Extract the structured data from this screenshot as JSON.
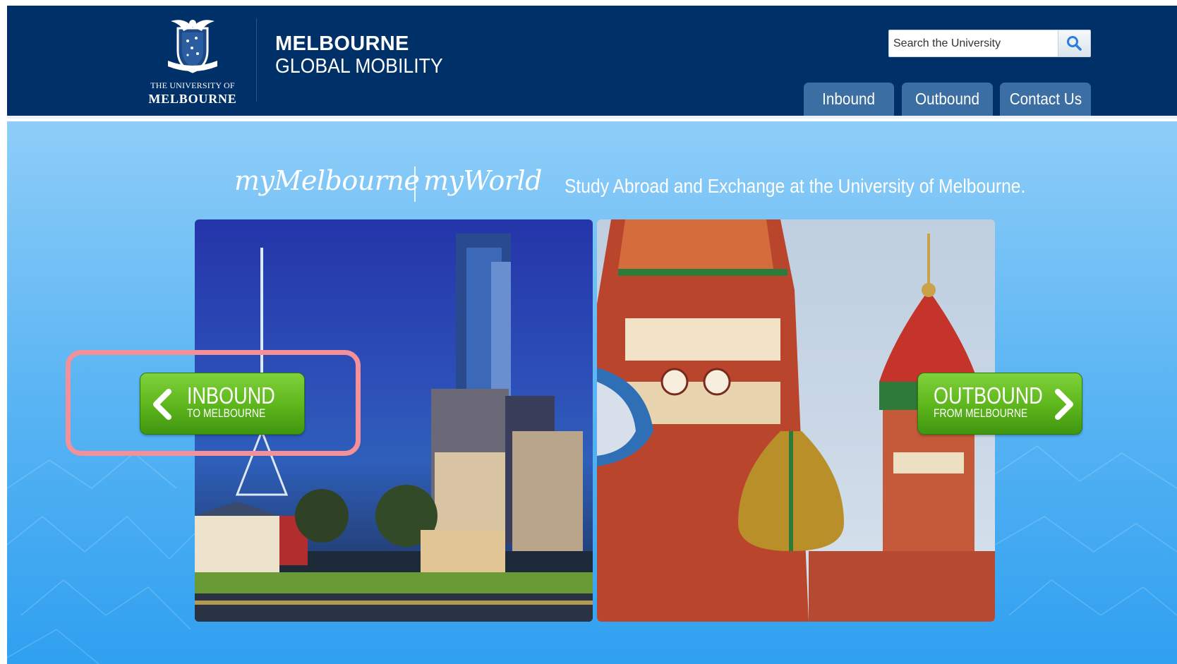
{
  "header": {
    "logo": {
      "line1": "THE UNIVERSITY OF",
      "line2": "MELBOURNE"
    },
    "site_title_line1": "MELBOURNE",
    "site_title_line2": "GLOBAL MOBILITY",
    "search": {
      "placeholder": "Search the University"
    },
    "nav": [
      {
        "label": "Inbound"
      },
      {
        "label": "Outbound"
      },
      {
        "label": "Contact Us"
      }
    ],
    "colors": {
      "background": "#003068",
      "tab": "#3b6ea2"
    }
  },
  "hero": {
    "tagline_script_1": "myMelbourne",
    "tagline_script_2": "myWorld",
    "tagline_text": "Study Abroad and Exchange at the University of Melbourne.",
    "inbound_cta": {
      "title": "INBOUND",
      "subtitle": "TO MELBOURNE"
    },
    "outbound_cta": {
      "title": "OUTBOUND",
      "subtitle": "FROM MELBOURNE"
    },
    "colors": {
      "background_top": "#8ecdf8",
      "background_bottom": "#2fa0f0",
      "cta_green": "#5fb81d",
      "highlight": "#f4909a"
    }
  }
}
